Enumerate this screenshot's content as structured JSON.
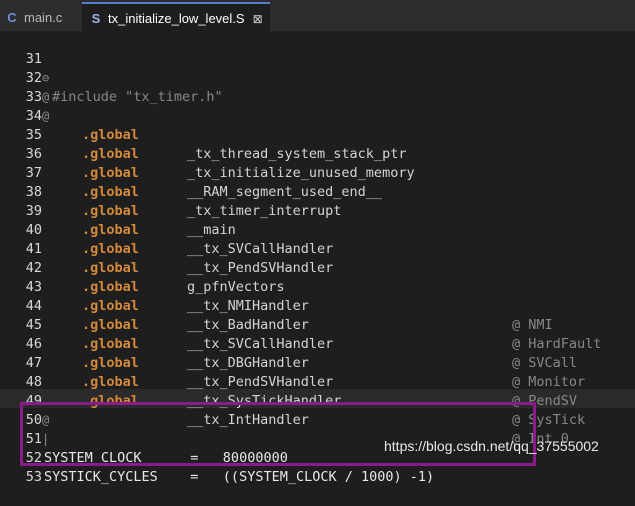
{
  "tabs": [
    {
      "icon": "c-file-icon",
      "label": "main.c",
      "active": false
    },
    {
      "icon": "s-file-icon",
      "label": "tx_initialize_low_level.S",
      "active": true,
      "close": "⊠"
    }
  ],
  "editor": {
    "lines": [
      {
        "num": "31",
        "fold": "⊖",
        "text": "#include \"tx_timer.h\""
      },
      {
        "num": "32",
        "fold": "@",
        "text": ""
      },
      {
        "num": "33",
        "fold": "@",
        "text": ""
      },
      {
        "num": "34",
        "directive": ".global",
        "symbol": "_tx_thread_system_stack_ptr",
        "comment": ""
      },
      {
        "num": "35",
        "directive": ".global",
        "symbol": "_tx_initialize_unused_memory",
        "comment": ""
      },
      {
        "num": "36",
        "directive": ".global",
        "symbol": "__RAM_segment_used_end__",
        "comment": ""
      },
      {
        "num": "37",
        "directive": ".global",
        "symbol": "_tx_timer_interrupt",
        "comment": ""
      },
      {
        "num": "38",
        "directive": ".global",
        "symbol": "__main",
        "comment": ""
      },
      {
        "num": "39",
        "directive": ".global",
        "symbol": "__tx_SVCallHandler",
        "comment": ""
      },
      {
        "num": "40",
        "directive": ".global",
        "symbol": "__tx_PendSVHandler",
        "comment": ""
      },
      {
        "num": "41",
        "directive": ".global",
        "symbol": "g_pfnVectors",
        "comment": ""
      },
      {
        "num": "42",
        "directive": ".global",
        "symbol": "__tx_NMIHandler",
        "comment": "@ NMI"
      },
      {
        "num": "43",
        "directive": ".global",
        "symbol": "__tx_BadHandler",
        "comment": "@ HardFault"
      },
      {
        "num": "44",
        "directive": ".global",
        "symbol": "__tx_SVCallHandler",
        "comment": "@ SVCall"
      },
      {
        "num": "45",
        "directive": ".global",
        "symbol": "__tx_DBGHandler",
        "comment": "@ Monitor"
      },
      {
        "num": "46",
        "directive": ".global",
        "symbol": "__tx_PendSVHandler",
        "comment": "@ PendSV"
      },
      {
        "num": "47",
        "directive": ".global",
        "symbol": "__tx_SysTickHandler",
        "comment": "@ SysTick"
      },
      {
        "num": "48",
        "directive": ".global",
        "symbol": "__tx_IntHandler",
        "comment": "@ Int 0"
      },
      {
        "num": "49",
        "fold": "@",
        "text": ""
      },
      {
        "num": "50",
        "fold": "",
        "text": ""
      },
      {
        "num": "51",
        "text": "SYSTEM_CLOCK      =   80000000"
      },
      {
        "num": "52",
        "text": "SYSTICK_CYCLES    =   ((SYSTEM_CLOCK / 1000) -1)"
      },
      {
        "num": "53",
        "text": ""
      }
    ]
  },
  "watermark": "https://blog.csdn.net/qq_37555002",
  "colors": {
    "directive": "#d58a3a",
    "highlight_box": "#8b1a8b",
    "background": "#1e1e1e"
  }
}
